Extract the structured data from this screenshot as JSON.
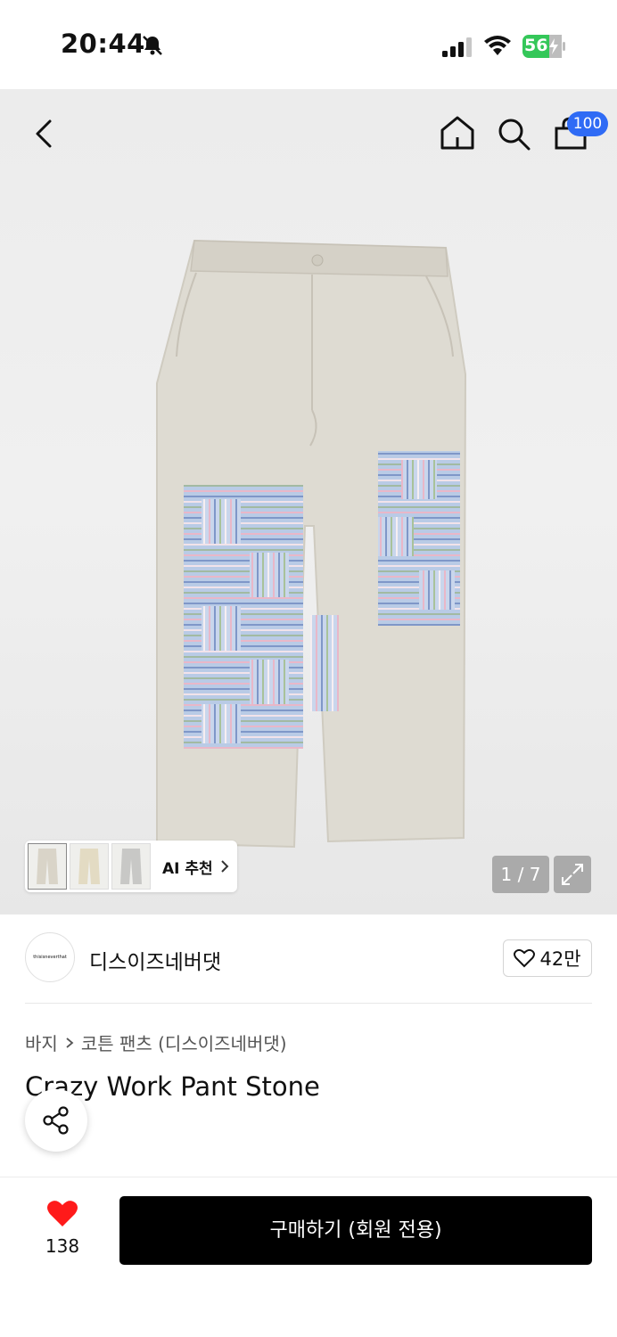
{
  "status_bar": {
    "time": "20:44",
    "battery": "56"
  },
  "header": {
    "cart_count": "100"
  },
  "gallery": {
    "ai_recommend_label": "AI 추천",
    "page_indicator": "1 / 7"
  },
  "brand": {
    "logo_text": "thisisneverthat",
    "name": "디스이즈네버댓",
    "likes": "42만"
  },
  "breadcrumb": {
    "category": "바지",
    "subcategory": "코튼 팬츠 (디스이즈네버댓)"
  },
  "product": {
    "title": "Crazy Work Pant Stone"
  },
  "bottom_bar": {
    "wish_count": "138",
    "buy_label": "구매하기 (회원 전용)"
  },
  "colors": {
    "accent_badge": "#2f6bf5",
    "heart": "#ff1a1a",
    "buy_button": "#000000",
    "battery_green": "#34c759"
  }
}
